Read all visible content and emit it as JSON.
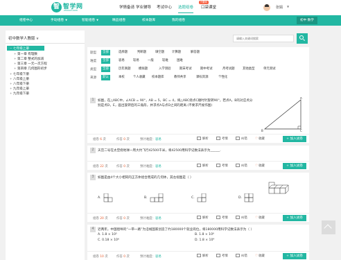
{
  "header": {
    "logo_name": "智学网",
    "logo_domain": "zhixue.com",
    "nav": [
      "学情备请",
      "学业辅导",
      "考试中心",
      "选题组卷",
      "口袋课堂"
    ],
    "active_index": 3,
    "hot_badge": "只要你",
    "username": "张娟",
    "user_caret": "▼"
  },
  "greenbar": {
    "items": [
      "组卷中心",
      "手动组卷",
      "智能组卷",
      "精品组卷",
      "校本题库",
      "我的组卷"
    ],
    "caret": "▼",
    "right_label": "初中 数学"
  },
  "sidebar": {
    "version": "初中数学人教版",
    "version_caret": "▼",
    "tree": [
      {
        "label": "七年级上册",
        "toggle": "−",
        "depth": 0,
        "selected": true
      },
      {
        "label": "第一章 有理数",
        "toggle": "+",
        "depth": 1,
        "selected": false
      },
      {
        "label": "第二章 整式的加减",
        "toggle": "+",
        "depth": 1,
        "selected": false
      },
      {
        "label": "第三章 一元一次方程",
        "toggle": "+",
        "depth": 1,
        "selected": false
      },
      {
        "label": "第四章 几何图形初步",
        "toggle": "+",
        "depth": 1,
        "selected": false
      },
      {
        "label": "七年级下册",
        "toggle": "+",
        "depth": 0,
        "selected": false
      },
      {
        "label": "八年级上册",
        "toggle": "+",
        "depth": 0,
        "selected": false
      },
      {
        "label": "八年级下册",
        "toggle": "+",
        "depth": 0,
        "selected": false
      },
      {
        "label": "九年级上册",
        "toggle": "+",
        "depth": 0,
        "selected": false
      },
      {
        "label": "九年级下册",
        "toggle": "+",
        "depth": 0,
        "selected": false
      }
    ]
  },
  "search": {
    "placeholder": "请输入关键词搜索"
  },
  "filters": {
    "rows": [
      {
        "label": "题型",
        "options": [
          "全部",
          "选择题",
          "判断题",
          "填空题",
          "计算题",
          "解答题"
        ],
        "selected": 0
      },
      {
        "label": "难度",
        "options": [
          "全部",
          "容易",
          "较易",
          "一般",
          "较难",
          "困难"
        ],
        "selected": 0
      },
      {
        "label": "类型",
        "options": [
          "全部",
          "历年真题",
          "模拟题",
          "入学测验",
          "期末考试",
          "期中考试",
          "月考试题",
          "其他类型",
          "单元测试"
        ],
        "selected": 0
      },
      {
        "label": "来源",
        "options": [
          "默认",
          "本校",
          "个人收藏",
          "校本题库",
          "教师共享",
          "课标资源",
          "个性化"
        ],
        "selected": 0
      }
    ]
  },
  "sortbar": {
    "tabs": [
      "综合排序",
      "组卷次数",
      "作答次数",
      "平均得分率"
    ],
    "selected": 0,
    "arrow": "↓",
    "total_prefix": "共",
    "total_count": "39764",
    "total_suffix": "题",
    "page": "第1/3977页",
    "prev": "‹",
    "next": "›"
  },
  "questions": [
    {
      "num": "1",
      "text": "如图，在△ABC中，∠ACB = 90°，AB = 5，BC = 4，将△ABC绕点C顺时针旋转90°，若点A，B的对应点分别是点D，E，画出旋转后的三角形，并求点A与点D之间的距离.(不要求尺规作图)",
      "diagram_labels": [
        "A",
        "B",
        "C"
      ],
      "meta": {
        "zujuan_prefix": "组卷",
        "zujuan": "6",
        "zujuan_suffix": "次",
        "zuoda_prefix": "作答",
        "zuoda": "0",
        "zuoda_suffix": "次",
        "difficulty_label": "预计难度：",
        "difficulty": "容易"
      }
    },
    {
      "num": "2",
      "text": "天宫二号在太空绕地球一周大约飞行42500千米，将42500用科学记数法表示为______.",
      "meta": {
        "zujuan_prefix": "组卷",
        "zujuan": "22",
        "zujuan_suffix": "次",
        "zuoda_prefix": "作答",
        "zuoda": "0",
        "zuoda_suffix": "次",
        "difficulty_label": "预计难度：",
        "difficulty": "容易"
      }
    },
    {
      "num": "3",
      "text": "如图是由4个大小相同的正方体组合而成的几何体，其左视图是（ ）",
      "options": [
        "A.",
        "B.",
        "C.",
        "D."
      ],
      "meta": {
        "zujuan_prefix": "组卷",
        "zujuan": "20",
        "zujuan_suffix": "次",
        "zuoda_prefix": "作答",
        "zuoda": "0",
        "zuoda_suffix": "次",
        "difficulty_label": "预计难度：",
        "difficulty": "容易"
      }
    },
    {
      "num": "4",
      "text": "近两年，中国倡导的“一带一路”为沿线国家创造了约180000个就业岗位，将180000用科学记数法表示为（ ）",
      "options": [
        "A. 1.8 × 10⁵",
        "B. 1.8 × 10⁶",
        "C. 0.18 × 10⁶",
        "D. 1.8 × 10⁴"
      ],
      "meta": {
        "zujuan_prefix": "组卷",
        "zujuan": "10",
        "zujuan_suffix": "次",
        "zuoda_prefix": "作答",
        "zuoda": "0",
        "zuoda_suffix": "次",
        "difficulty_label": "预计难度：",
        "difficulty": "容易"
      }
    }
  ],
  "actions": {
    "analysis": "解析",
    "exam": "考情",
    "report": "纠错",
    "favorite": "收藏",
    "add": "加入试卷",
    "add_plus": "+"
  }
}
